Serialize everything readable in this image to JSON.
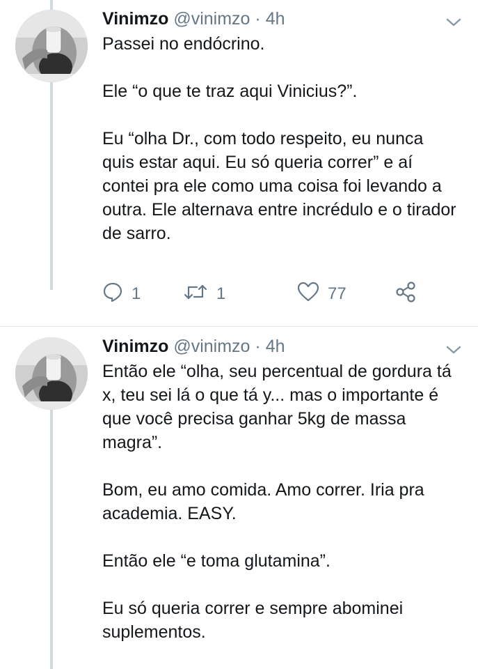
{
  "tweets": [
    {
      "name": "Vinimzo",
      "handle": "@vinimzo",
      "separator": "·",
      "time": "4h",
      "paragraphs": [
        "Passei no endócrino.",
        "Ele “o que te traz aqui Vinicius?”.",
        "Eu “olha Dr., com todo respeito, eu nunca quis estar aqui. Eu só queria correr” e aí contei pra ele como uma coisa foi levando a outra. Ele alternava entre incrédulo e o tirador de sarro."
      ],
      "actions": {
        "replies": "1",
        "retweets": "1",
        "likes": "77"
      }
    },
    {
      "name": "Vinimzo",
      "handle": "@vinimzo",
      "separator": "·",
      "time": "4h",
      "paragraphs": [
        "Então ele “olha, seu percentual de gordura tá x, teu sei lá o que tá y... mas o importante é que você precisa ganhar 5kg de massa magra”.",
        "Bom, eu amo comida. Amo correr. Iria pra academia. EASY.",
        "Então ele “e toma glutamina”.",
        "Eu só queria correr e sempre abominei suplementos."
      ]
    }
  ],
  "icons": {
    "reply": "reply-icon",
    "retweet": "retweet-icon",
    "like": "heart-icon",
    "share": "share-icon",
    "caret": "chevron-down-icon"
  },
  "colors": {
    "text": "#14171a",
    "secondary": "#657786",
    "thread_line": "#cfd9de"
  }
}
